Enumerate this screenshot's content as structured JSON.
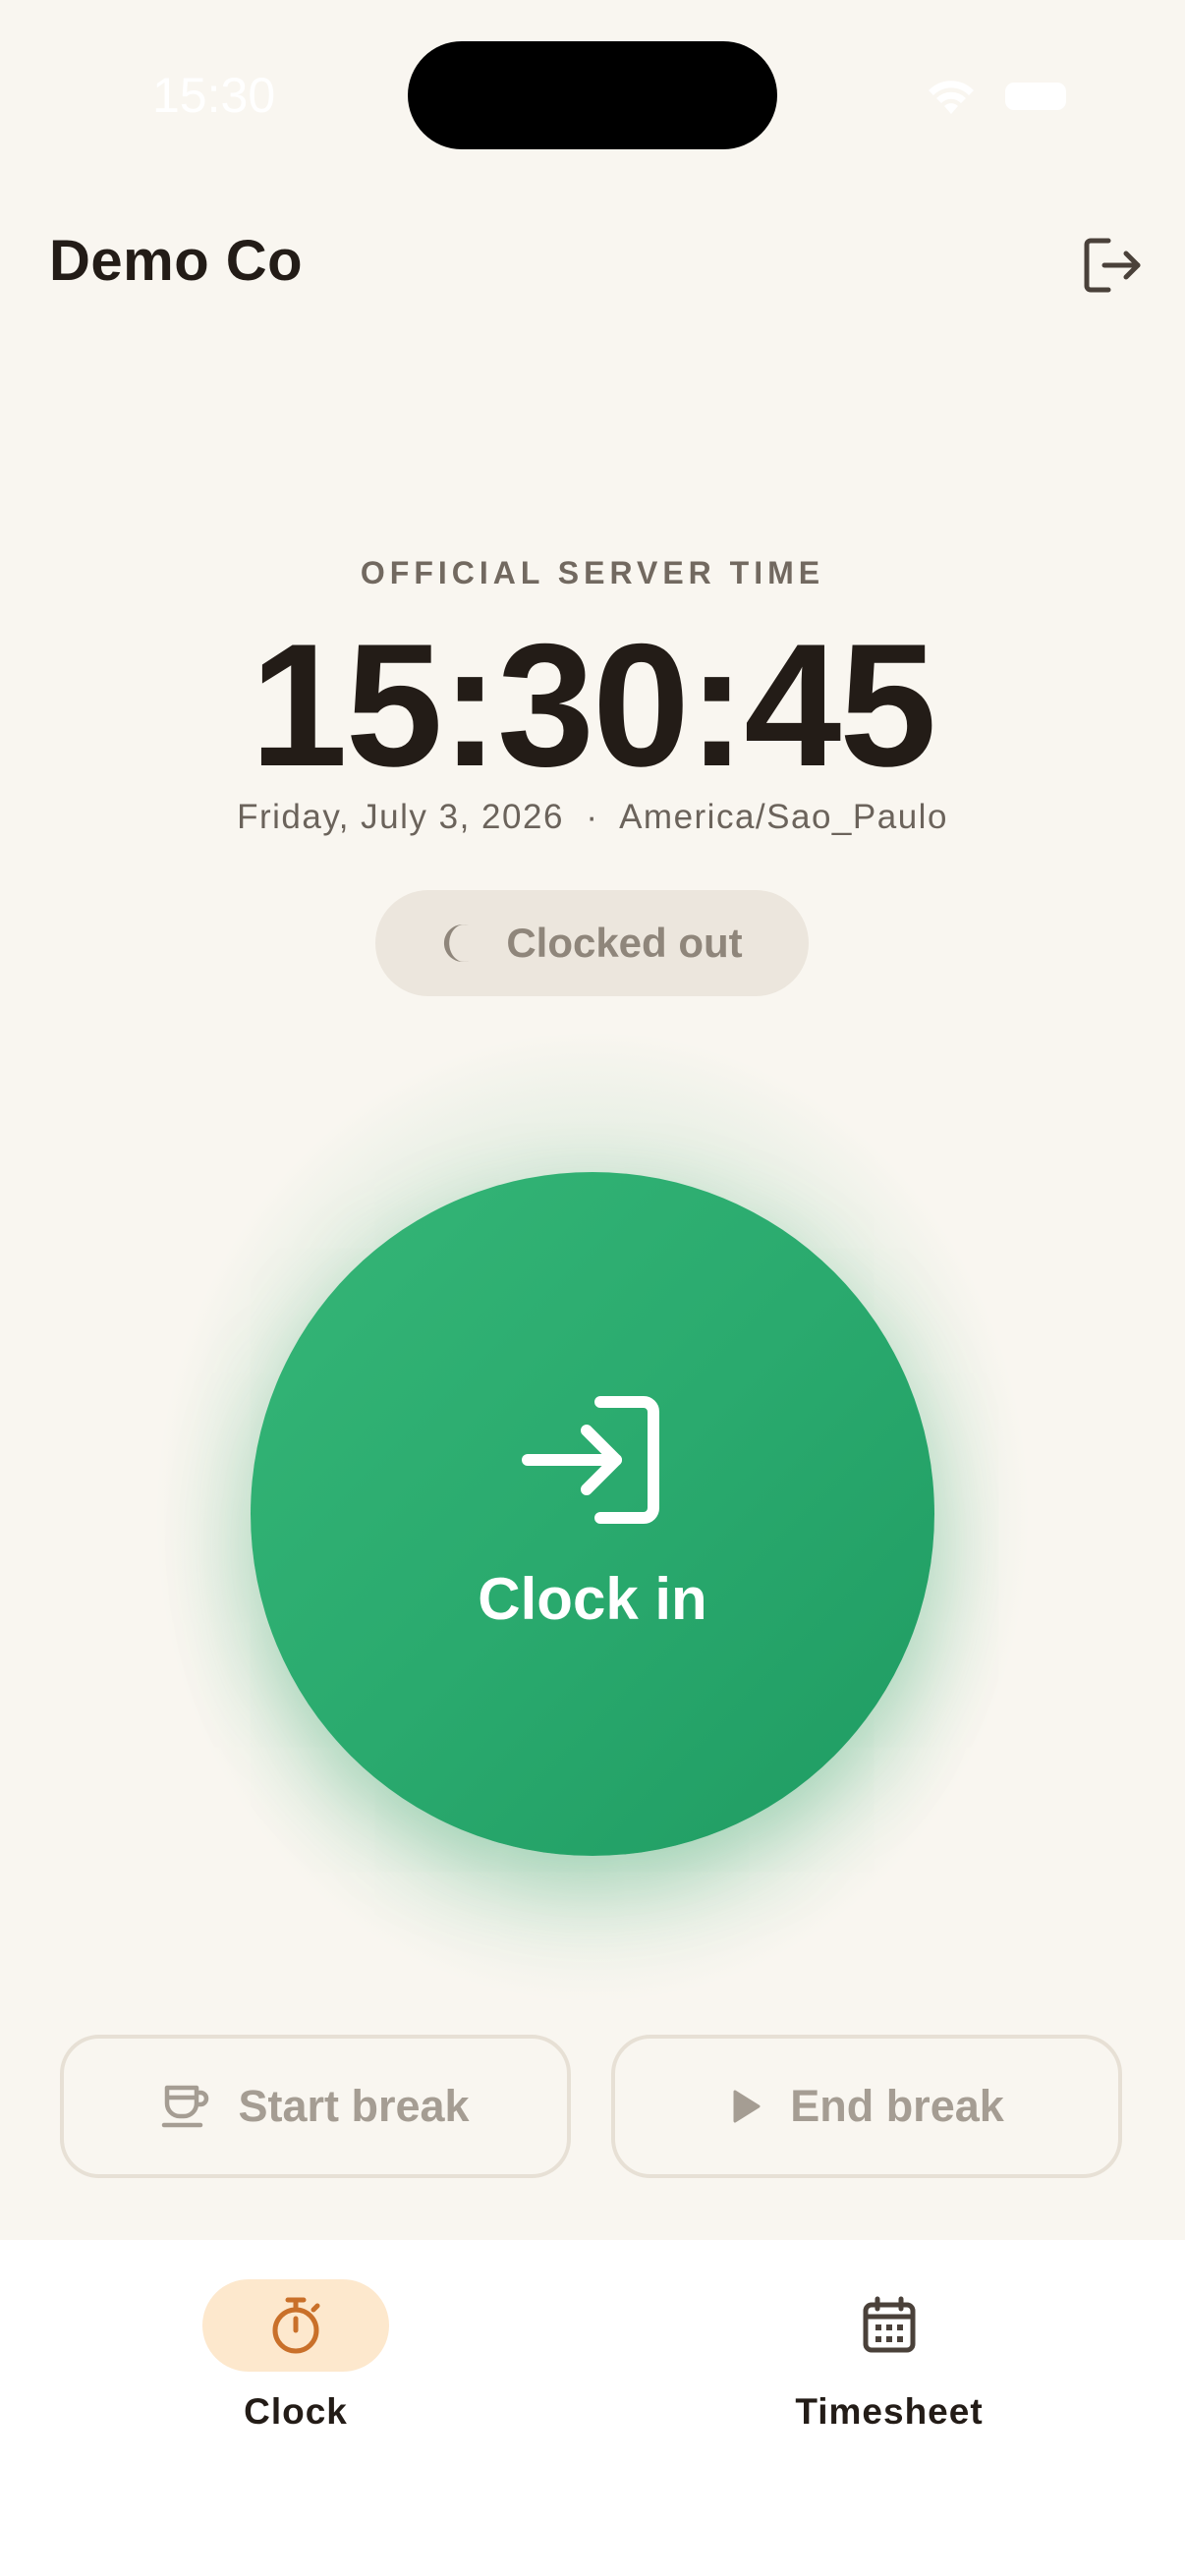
{
  "status_bar": {
    "time": "15:30"
  },
  "header": {
    "title": "Demo Co",
    "logout_icon": "logout-icon"
  },
  "server": {
    "label": "OFFICIAL SERVER TIME",
    "time": "15:30:45",
    "date": "Friday, July 3, 2026",
    "separator": "·",
    "timezone": "America/Sao_Paulo"
  },
  "status": {
    "label": "Clocked out",
    "icon": "moon-icon"
  },
  "clock_in": {
    "label": "Clock in",
    "icon": "login-icon",
    "color": "#2AAA6E"
  },
  "breaks": {
    "start_label": "Start break",
    "start_icon": "coffee-cup-icon",
    "end_label": "End break",
    "end_icon": "play-icon"
  },
  "nav": {
    "items": [
      {
        "label": "Clock",
        "icon": "stopwatch-icon",
        "active": true,
        "accent": "#C9702A"
      },
      {
        "label": "Timesheet",
        "icon": "calendar-icon",
        "active": false
      }
    ]
  },
  "colors": {
    "background": "#F9F6F0",
    "text": "#231C17",
    "muted": "#8F867B",
    "nav_active_bg": "#FDE8CD"
  }
}
